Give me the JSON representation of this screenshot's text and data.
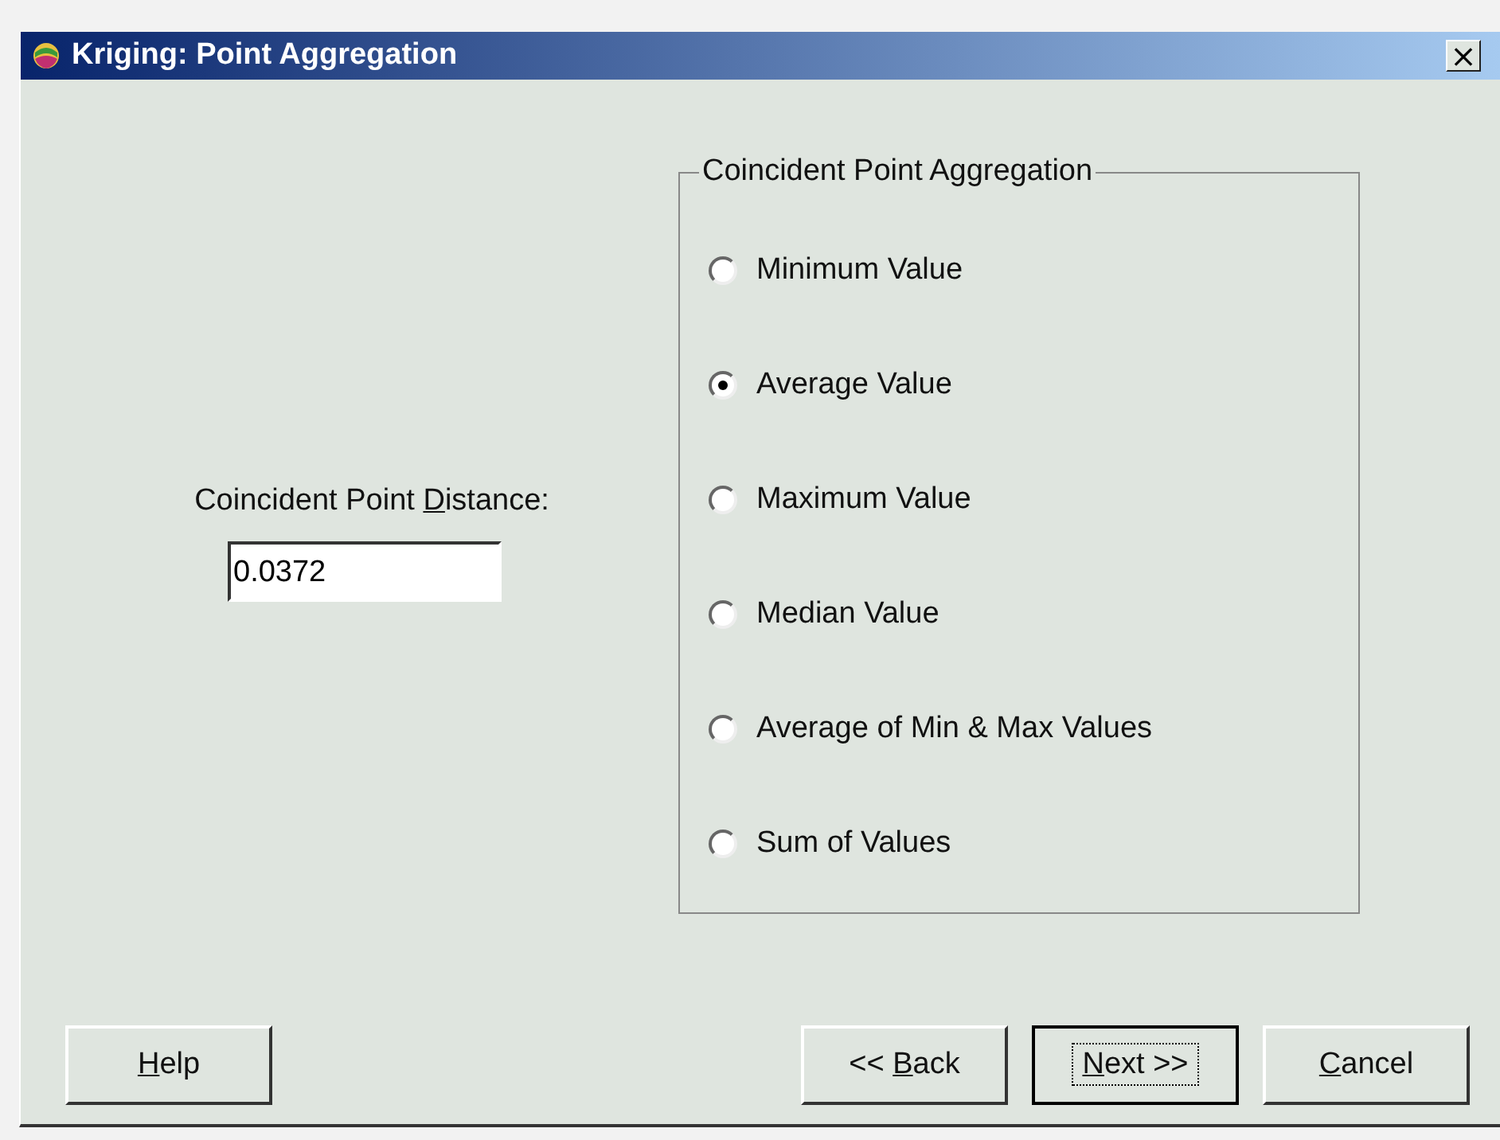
{
  "window": {
    "title": "Kriging: Point Aggregation",
    "close": "×"
  },
  "distance": {
    "label": {
      "pre": "Coincident Point ",
      "key": "D",
      "post": "istance:"
    },
    "value": "0.0372"
  },
  "aggregation": {
    "title": "Coincident Point Aggregation",
    "options": [
      {
        "label": "Minimum Value",
        "selected": false
      },
      {
        "label": "Average Value",
        "selected": true
      },
      {
        "label": "Maximum Value",
        "selected": false
      },
      {
        "label": "Median Value",
        "selected": false
      },
      {
        "label": "Average of Min & Max Values",
        "selected": false
      },
      {
        "label": "Sum of Values",
        "selected": false
      }
    ]
  },
  "buttons": [
    {
      "label": {
        "key": "H",
        "post": "elp"
      },
      "default": false
    },
    {
      "label": {
        "pre": "<< ",
        "key": "B",
        "post": "ack"
      },
      "default": false
    },
    {
      "label": {
        "key": "N",
        "post": "ext >>"
      },
      "default": true
    },
    {
      "label": {
        "key": "C",
        "post": "ancel"
      },
      "default": false
    }
  ]
}
